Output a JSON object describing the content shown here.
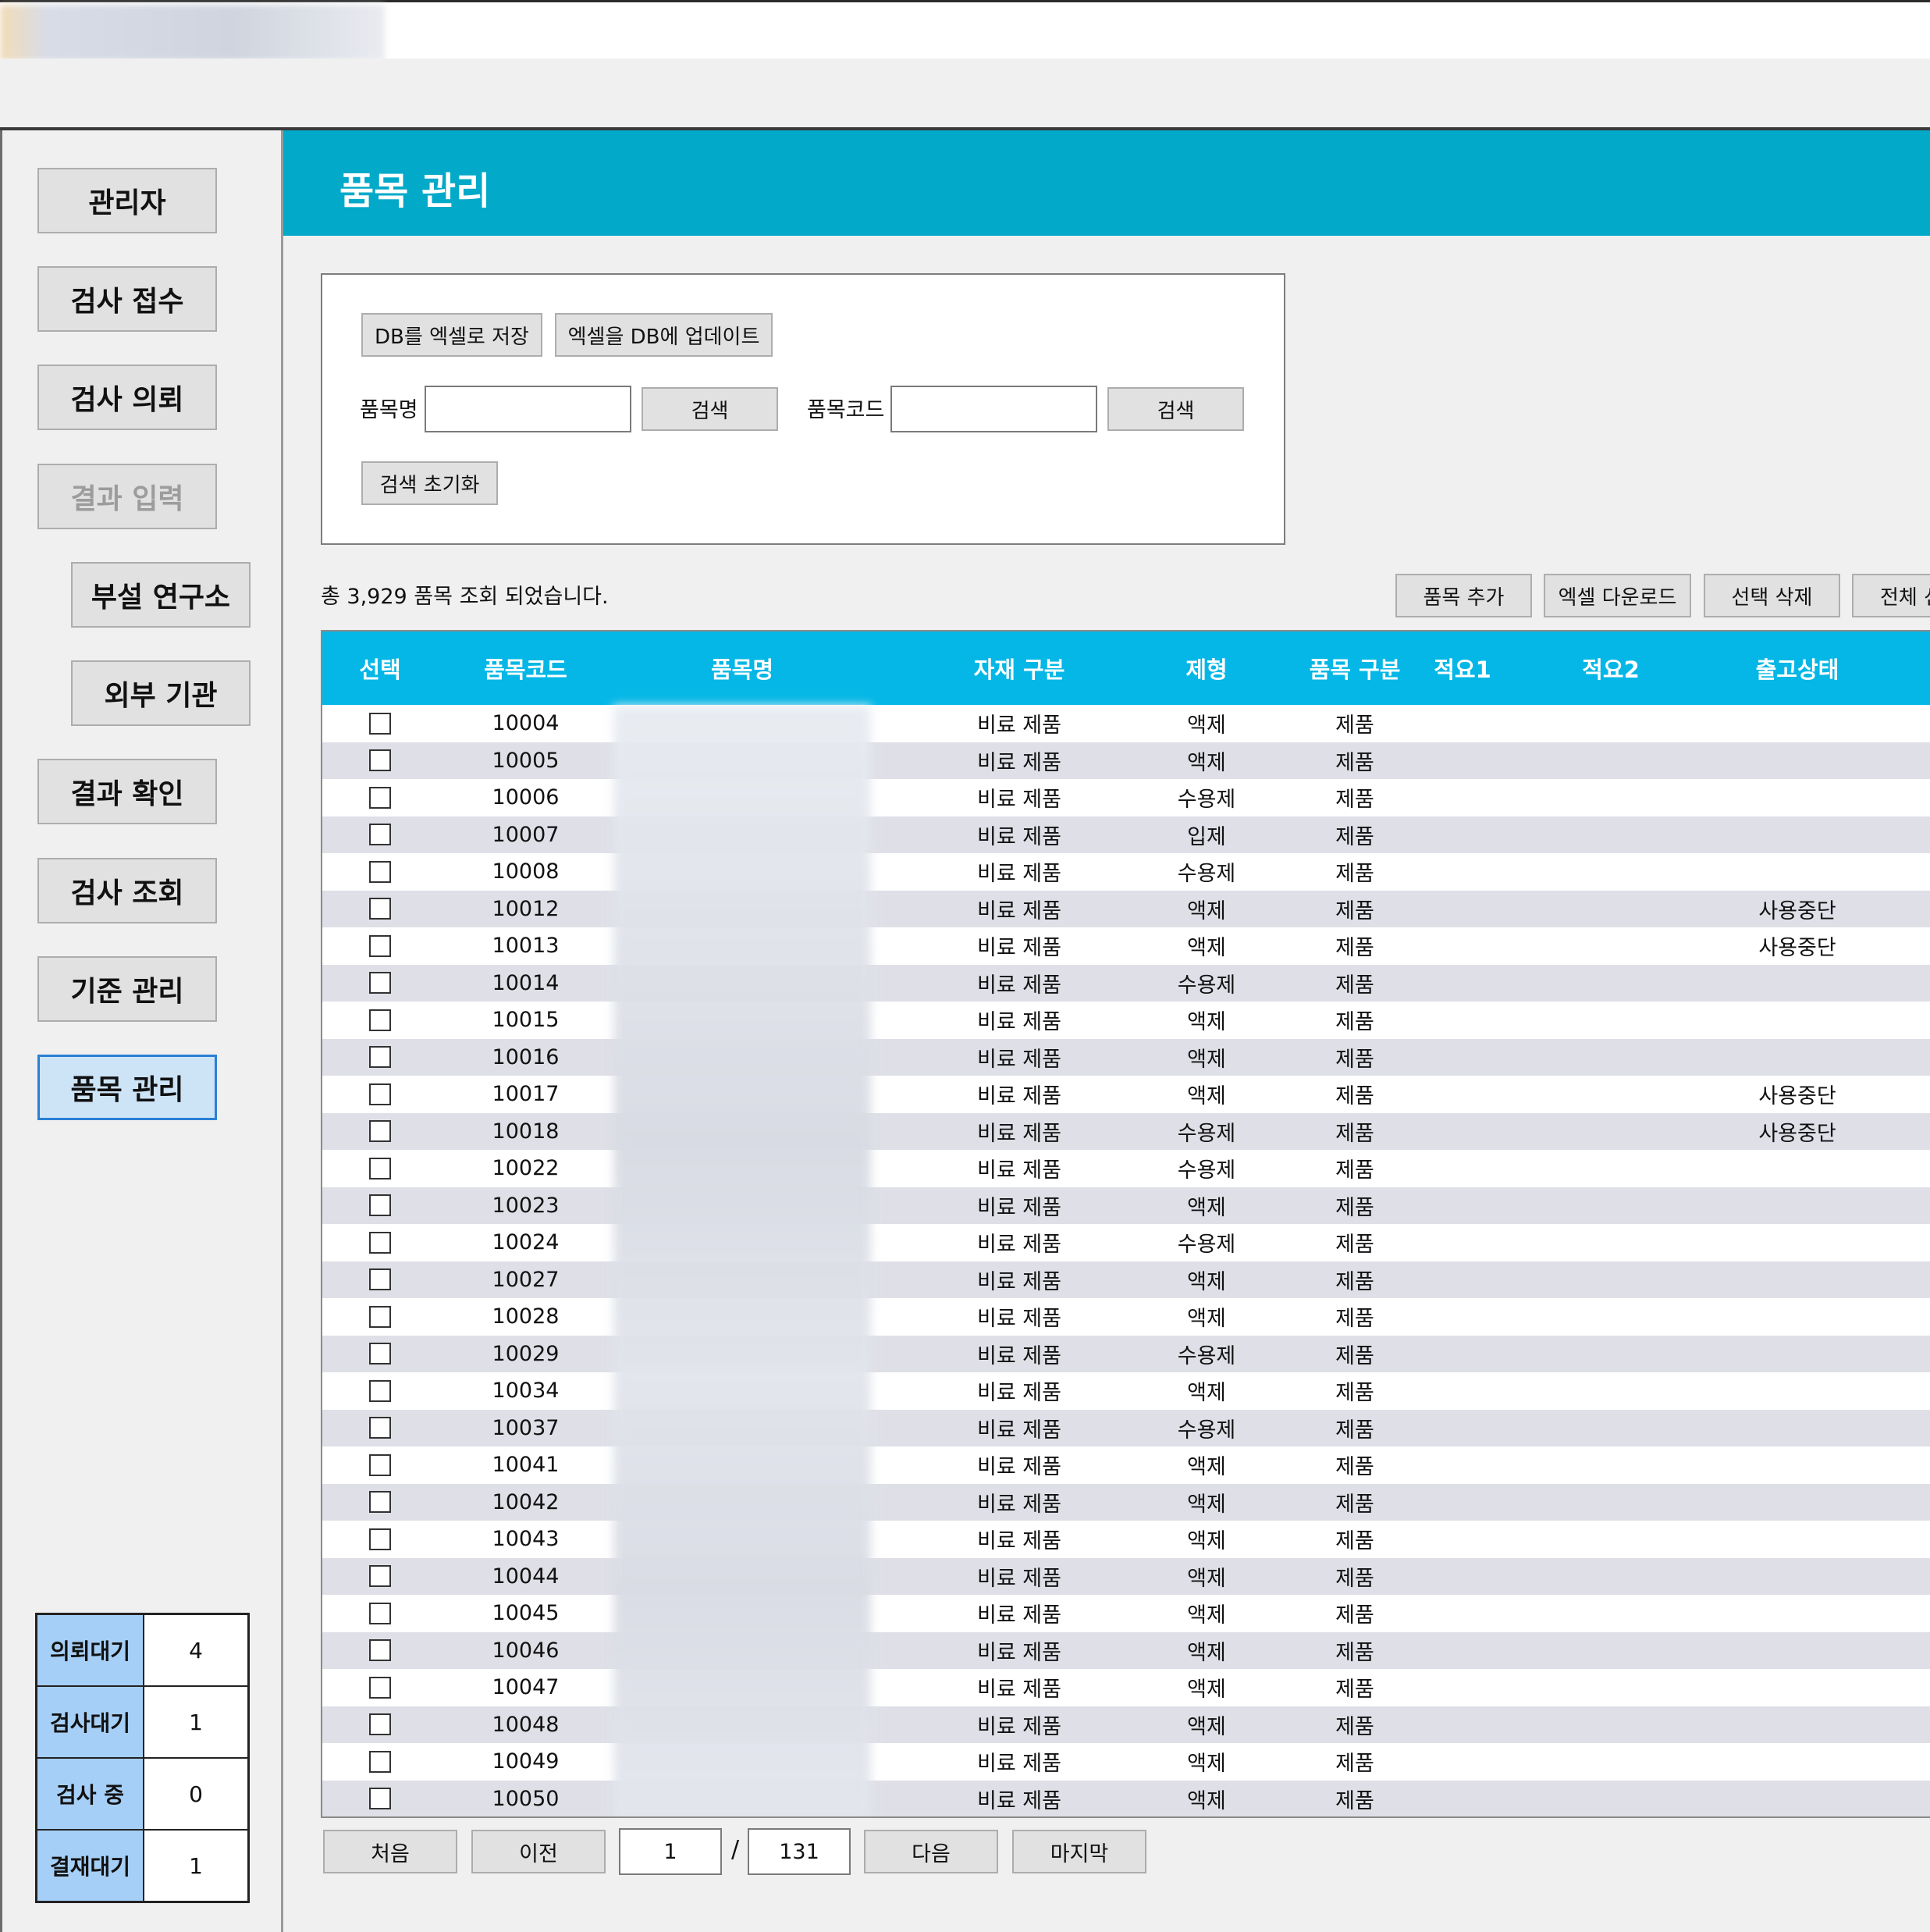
{
  "window": {
    "title": ""
  },
  "sidebar": {
    "items": [
      {
        "label": "관리자",
        "state": "normal"
      },
      {
        "label": "검사 접수",
        "state": "normal"
      },
      {
        "label": "검사 의뢰",
        "state": "normal"
      },
      {
        "label": "결과 입력",
        "state": "disabled"
      },
      {
        "label": "부설 연구소",
        "state": "normal"
      },
      {
        "label": "외부 기관",
        "state": "normal"
      },
      {
        "label": "결과 확인",
        "state": "normal"
      },
      {
        "label": "검사 조회",
        "state": "normal"
      },
      {
        "label": "기준 관리",
        "state": "normal"
      },
      {
        "label": "품목 관리",
        "state": "active"
      }
    ],
    "stats": [
      {
        "label": "의뢰대기",
        "value": "4"
      },
      {
        "label": "검사대기",
        "value": "1"
      },
      {
        "label": "검사 중",
        "value": "0"
      },
      {
        "label": "결재대기",
        "value": "1"
      }
    ]
  },
  "header": {
    "title": "품목 관리",
    "color": "#03a9c9"
  },
  "search": {
    "db_to_excel": "DB를 엑셀로 저장",
    "excel_to_db": "엑셀을 DB에 업데이트",
    "name_label": "품목명",
    "name_value": "",
    "search1": "검색",
    "code_label": "품목코드",
    "code_value": "",
    "search2": "검색",
    "reset": "검색 초기화"
  },
  "summary": "총 3,929 품목 조회 되었습니다.",
  "actions": {
    "add": "품목 추가",
    "excel_download": "엑셀 다운로드",
    "delete_selected": "선택 삭제",
    "all": "전체 선"
  },
  "grid": {
    "columns": [
      "선택",
      "품목코드",
      "품목명",
      "자재 구분",
      "제형",
      "품목 구분",
      "적요1",
      "적요2",
      "출고상태"
    ],
    "header_color": "#04b7e6",
    "rows": [
      {
        "code": "10004",
        "cat": "비료 제품",
        "form": "액제",
        "type": "제품",
        "status": ""
      },
      {
        "code": "10005",
        "cat": "비료 제품",
        "form": "액제",
        "type": "제품",
        "status": ""
      },
      {
        "code": "10006",
        "cat": "비료 제품",
        "form": "수용제",
        "type": "제품",
        "status": ""
      },
      {
        "code": "10007",
        "cat": "비료 제품",
        "form": "입제",
        "type": "제품",
        "status": ""
      },
      {
        "code": "10008",
        "cat": "비료 제품",
        "form": "수용제",
        "type": "제품",
        "status": ""
      },
      {
        "code": "10012",
        "cat": "비료 제품",
        "form": "액제",
        "type": "제품",
        "status": "사용중단"
      },
      {
        "code": "10013",
        "cat": "비료 제품",
        "form": "액제",
        "type": "제품",
        "status": "사용중단"
      },
      {
        "code": "10014",
        "cat": "비료 제품",
        "form": "수용제",
        "type": "제품",
        "status": ""
      },
      {
        "code": "10015",
        "cat": "비료 제품",
        "form": "액제",
        "type": "제품",
        "status": ""
      },
      {
        "code": "10016",
        "cat": "비료 제품",
        "form": "액제",
        "type": "제품",
        "status": ""
      },
      {
        "code": "10017",
        "cat": "비료 제품",
        "form": "액제",
        "type": "제품",
        "status": "사용중단"
      },
      {
        "code": "10018",
        "cat": "비료 제품",
        "form": "수용제",
        "type": "제품",
        "status": "사용중단"
      },
      {
        "code": "10022",
        "cat": "비료 제품",
        "form": "수용제",
        "type": "제품",
        "status": ""
      },
      {
        "code": "10023",
        "cat": "비료 제품",
        "form": "액제",
        "type": "제품",
        "status": ""
      },
      {
        "code": "10024",
        "cat": "비료 제품",
        "form": "수용제",
        "type": "제품",
        "status": ""
      },
      {
        "code": "10027",
        "cat": "비료 제품",
        "form": "액제",
        "type": "제품",
        "status": ""
      },
      {
        "code": "10028",
        "cat": "비료 제품",
        "form": "액제",
        "type": "제품",
        "status": ""
      },
      {
        "code": "10029",
        "cat": "비료 제품",
        "form": "수용제",
        "type": "제품",
        "status": ""
      },
      {
        "code": "10034",
        "cat": "비료 제품",
        "form": "액제",
        "type": "제품",
        "status": ""
      },
      {
        "code": "10037",
        "cat": "비료 제품",
        "form": "수용제",
        "type": "제품",
        "status": ""
      },
      {
        "code": "10041",
        "cat": "비료 제품",
        "form": "액제",
        "type": "제품",
        "status": ""
      },
      {
        "code": "10042",
        "cat": "비료 제품",
        "form": "액제",
        "type": "제품",
        "status": ""
      },
      {
        "code": "10043",
        "cat": "비료 제품",
        "form": "액제",
        "type": "제품",
        "status": ""
      },
      {
        "code": "10044",
        "cat": "비료 제품",
        "form": "액제",
        "type": "제품",
        "status": ""
      },
      {
        "code": "10045",
        "cat": "비료 제품",
        "form": "액제",
        "type": "제품",
        "status": ""
      },
      {
        "code": "10046",
        "cat": "비료 제품",
        "form": "액제",
        "type": "제품",
        "status": ""
      },
      {
        "code": "10047",
        "cat": "비료 제품",
        "form": "액제",
        "type": "제품",
        "status": ""
      },
      {
        "code": "10048",
        "cat": "비료 제품",
        "form": "액제",
        "type": "제품",
        "status": ""
      },
      {
        "code": "10049",
        "cat": "비료 제품",
        "form": "액제",
        "type": "제품",
        "status": ""
      },
      {
        "code": "10050",
        "cat": "비료 제품",
        "form": "액제",
        "type": "제품",
        "status": ""
      }
    ]
  },
  "pager": {
    "first": "처음",
    "prev": "이전",
    "current": "1",
    "sep": "/",
    "total": "131",
    "next": "다음",
    "last": "마지막"
  }
}
